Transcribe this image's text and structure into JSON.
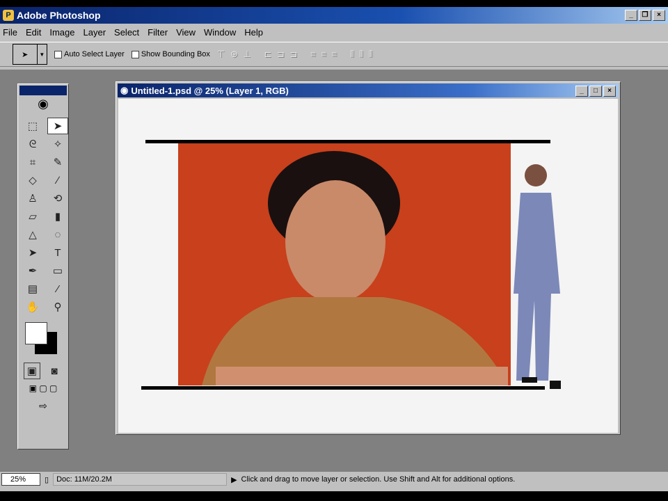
{
  "app": {
    "title": "Adobe Photoshop"
  },
  "menu": [
    "File",
    "Edit",
    "Image",
    "Layer",
    "Select",
    "Filter",
    "View",
    "Window",
    "Help"
  ],
  "options": {
    "auto_select": "Auto Select Layer",
    "bounding_box": "Show Bounding Box"
  },
  "document": {
    "title": "Untitled-1.psd @ 25% (Layer 1, RGB)"
  },
  "status": {
    "zoom": "25%",
    "doc": "Doc: 11M/20.2M",
    "hint": "Click and drag to move layer or selection. Use Shift and Alt for additional options."
  },
  "colors": {
    "accent": "#0a246a",
    "photo_bg": "#c8401c"
  }
}
